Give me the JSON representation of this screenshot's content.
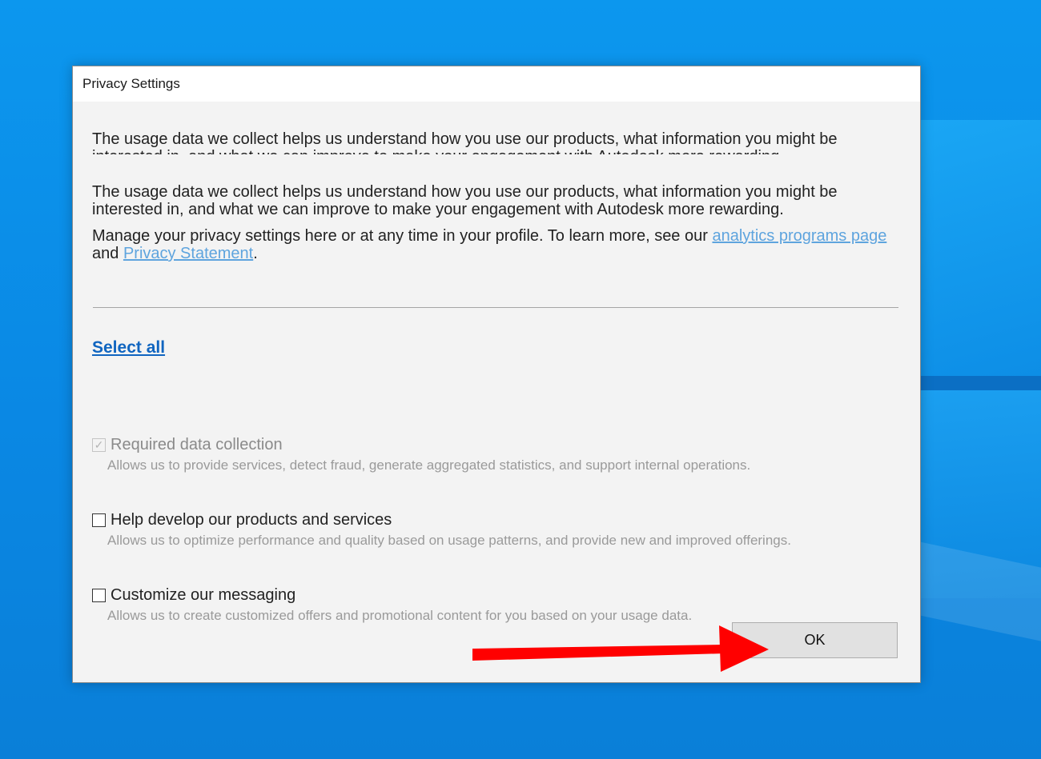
{
  "dialog": {
    "title": "Privacy Settings",
    "intro_scrolled": "The usage data we collect helps us understand how you use our products, what information you might be interested in, and what we can improve to make your engagement with Autodesk more rewarding.",
    "intro": "The usage data we collect helps us understand how you use our products, what information you might be interested in, and what we can improve to make your engagement with Autodesk more rewarding.",
    "manage_text_before": "Manage your privacy settings here or at any time in your profile. To learn more, see our ",
    "analytics_link": "analytics programs page",
    "manage_text_and": " and ",
    "privacy_link": "Privacy Statement",
    "manage_text_end": ".",
    "select_all": "Select all",
    "options": [
      {
        "label": "Required data collection",
        "description": "Allows us to provide services, detect fraud, generate aggregated statistics, and support internal operations.",
        "checked": true,
        "disabled": true
      },
      {
        "label": "Help develop our products and services",
        "description": "Allows us to optimize performance and quality based on usage patterns, and provide new and improved offerings.",
        "checked": false,
        "disabled": false
      },
      {
        "label": "Customize our messaging",
        "description": "Allows us to create customized offers and promotional content for you based on your usage data.",
        "checked": false,
        "disabled": false
      }
    ],
    "ok_label": "OK"
  },
  "colors": {
    "link": "#5ea4de",
    "select_all": "#1065c0",
    "arrow": "#ff0000"
  },
  "icons": {
    "checkmark": "check-icon",
    "annotation": "red-arrow-icon"
  }
}
